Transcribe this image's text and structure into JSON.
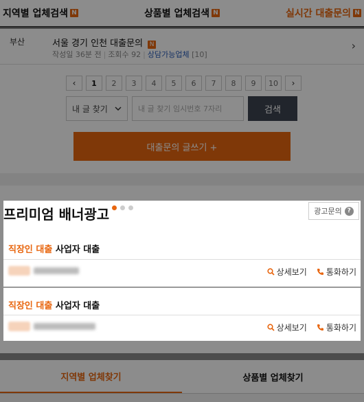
{
  "top_tabs": [
    {
      "label": "지역별 업체검색",
      "badge": "N"
    },
    {
      "label": "상품별 업체검색",
      "badge": "N"
    },
    {
      "label": "실시간 대출문의",
      "badge": "N",
      "active": true
    }
  ],
  "list_item": {
    "region": "부산",
    "title": "서울 경기 인천 대출문의",
    "badge": "N",
    "meta_time": "작성일 36분 전",
    "meta_views": "조회수 92",
    "meta_link": "상담가능업체",
    "meta_count": "[10]",
    "arrow": "›"
  },
  "pagination": {
    "prev": "‹",
    "pages": [
      "1",
      "2",
      "3",
      "4",
      "5",
      "6",
      "7",
      "8",
      "9",
      "10"
    ],
    "current": "1",
    "next": "›"
  },
  "search": {
    "select_value": "내 글 찾기",
    "input_placeholder": "내 글 찾기 임시번호 7자리",
    "button_label": "검색"
  },
  "write_button": "대출문의 글쓰기 +",
  "premium": {
    "title": "프리미엄 배너광고",
    "inquiry_label": "광고문의",
    "inquiry_icon": "?",
    "ads": [
      {
        "category": "직장인 대출",
        "title": "사업자 대출",
        "detail": "상세보기",
        "call": "통화하기"
      },
      {
        "category": "직장인 대출",
        "title": "사업자 대출",
        "detail": "상세보기",
        "call": "통화하기"
      }
    ]
  },
  "bottom_tabs": [
    {
      "label": "지역별 업체찾기",
      "active": true
    },
    {
      "label": "상품별 업체찾기"
    }
  ],
  "colors": {
    "accent": "#e8660f",
    "link": "#2a5cb8",
    "dark_button": "#3d4450"
  }
}
